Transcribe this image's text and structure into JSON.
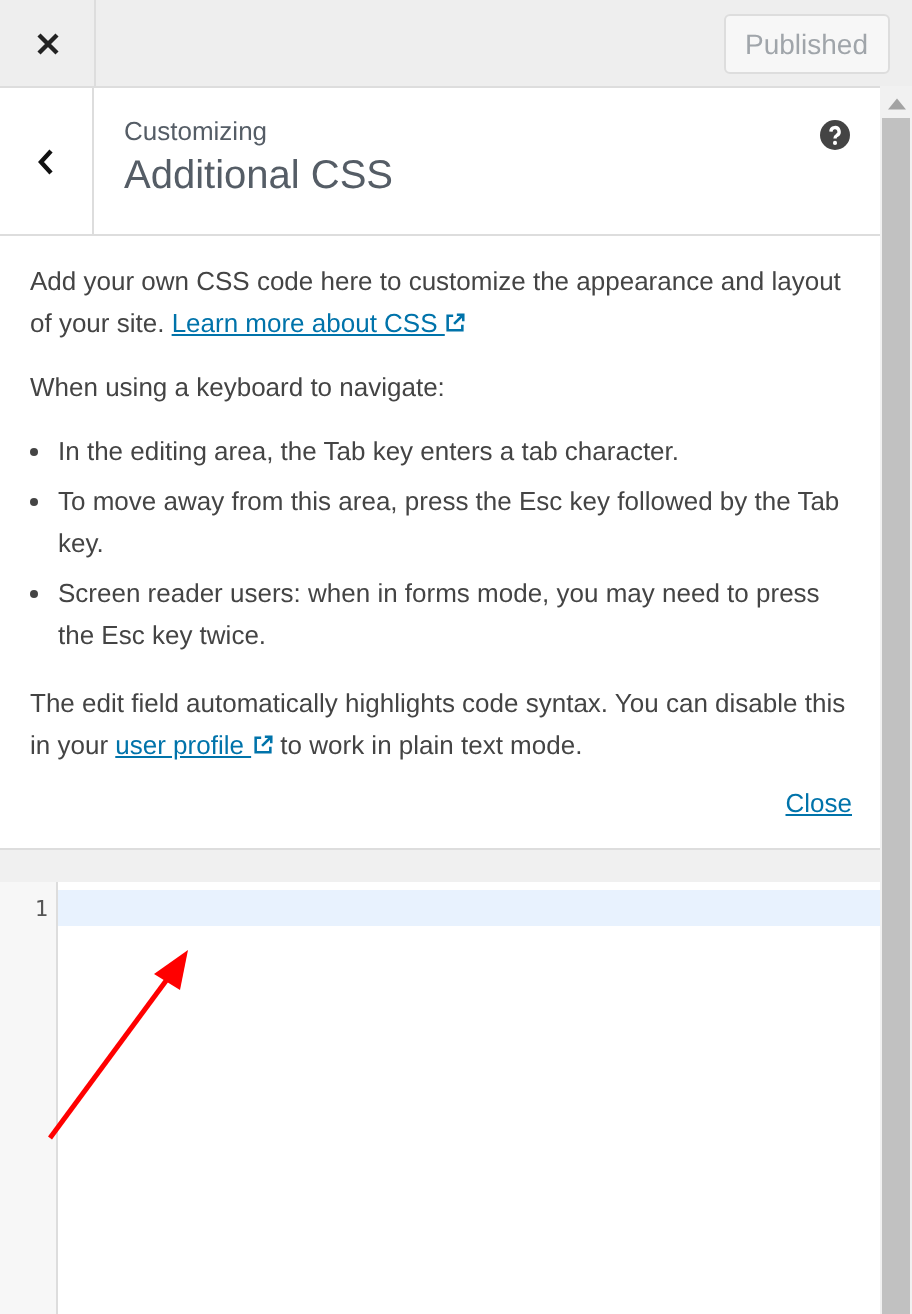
{
  "top_bar": {
    "publish_button": {
      "label": "Published",
      "disabled": true
    }
  },
  "section": {
    "breadcrumb": "Customizing",
    "title": "Additional CSS"
  },
  "description": {
    "intro": {
      "text": "Add your own CSS code here to customize the appearance and layout of your site.",
      "link": "Learn more about CSS"
    },
    "keyboard_heading": "When using a keyboard to navigate:",
    "bullets": [
      "In the editing area, the Tab key enters a tab character.",
      "To move away from this area, press the Esc key followed by the Tab key.",
      "Screen reader users: when in forms mode, you may need to press the Esc key twice."
    ],
    "syntax_note": {
      "before": "The edit field automatically highlights code syntax. You can disable this in your",
      "link": "user profile",
      "after": "to work in plain text mode."
    },
    "close_link": "Close"
  },
  "editor": {
    "lines": [
      {
        "number": "1",
        "selected": true
      }
    ]
  }
}
